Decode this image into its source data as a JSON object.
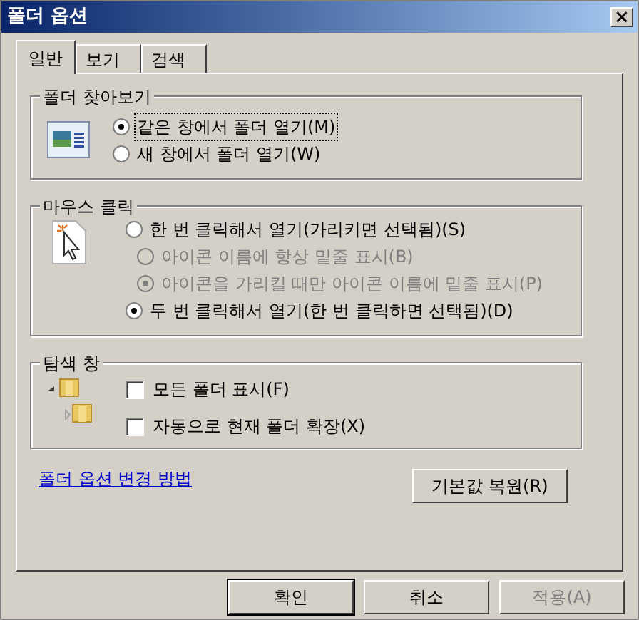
{
  "window": {
    "title": "폴더 옵션",
    "close": "×"
  },
  "tabs": [
    {
      "label": "일반",
      "selected": true
    },
    {
      "label": "보기",
      "selected": false
    },
    {
      "label": "검색",
      "selected": false
    }
  ],
  "browse_folders": {
    "title": "폴더 찾아보기",
    "options": [
      {
        "label": "같은 창에서 폴더 열기(M)",
        "selected": true,
        "focused": true
      },
      {
        "label": "새 창에서 폴더 열기(W)",
        "selected": false,
        "focused": false
      }
    ]
  },
  "mouse_click": {
    "title": "마우스 클릭",
    "options": [
      {
        "label": "한 번 클릭해서 열기(가리키면 선택됨)(S)",
        "selected": false,
        "disabled": false,
        "children": [
          {
            "label": "아이콘 이름에 항상 밑줄 표시(B)",
            "selected": false,
            "disabled": true
          },
          {
            "label": "아이콘을 가리킬 때만 아이콘 이름에 밑줄 표시(P)",
            "selected": true,
            "disabled": true
          }
        ]
      },
      {
        "label": "두 번 클릭해서 열기(한 번 클릭하면 선택됨)(D)",
        "selected": true,
        "disabled": false
      }
    ]
  },
  "navigation_pane": {
    "title": "탐색 창",
    "checkboxes": [
      {
        "label": "모든 폴더 표시(F)",
        "checked": false
      },
      {
        "label": "자동으로 현재 폴더 확장(X)",
        "checked": false
      }
    ]
  },
  "help_link": "폴더 옵션 변경 방법",
  "restore_button": "기본값 복원(R)",
  "buttons": [
    {
      "label": "확인",
      "default": true,
      "disabled": false
    },
    {
      "label": "취소",
      "default": false,
      "disabled": false
    },
    {
      "label": "적용(A)",
      "default": false,
      "disabled": true
    }
  ]
}
